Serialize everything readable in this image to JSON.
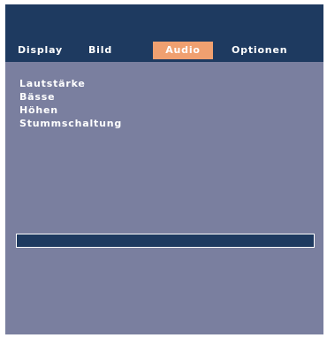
{
  "tabs": [
    {
      "label": "Display"
    },
    {
      "label": "Bild"
    },
    {
      "label": "Audio"
    },
    {
      "label": "Optionen"
    }
  ],
  "active_tab": "Audio",
  "menu": {
    "items": [
      {
        "label": "Lautstärke"
      },
      {
        "label": "Bässe"
      },
      {
        "label": "Höhen"
      },
      {
        "label": "Stummschaltung"
      }
    ]
  },
  "colors": {
    "header": "#1e3a60",
    "panel": "#7a7f9f",
    "active_tab": "#f0a070",
    "text": "#ffffff"
  }
}
